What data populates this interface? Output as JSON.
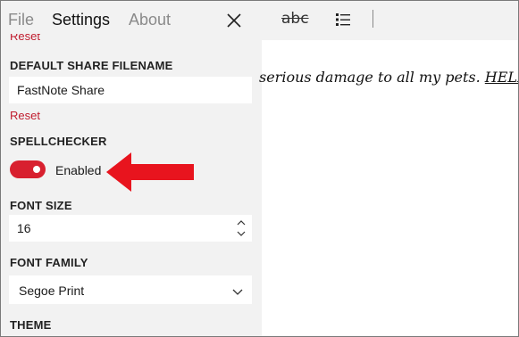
{
  "tabs": {
    "file": "File",
    "settings": "Settings",
    "about": "About"
  },
  "settings": {
    "reset_top": "Reset",
    "share_filename": {
      "label": "DEFAULT SHARE FILENAME",
      "value": "FastNote Share",
      "reset": "Reset"
    },
    "spellchecker": {
      "label": "SPELLCHECKER",
      "state": "Enabled",
      "on": true
    },
    "font_size": {
      "label": "FONT SIZE",
      "value": "16"
    },
    "font_family": {
      "label": "FONT FAMILY",
      "value": "Segoe Print"
    },
    "theme": {
      "label": "THEME"
    }
  },
  "toolbar": {
    "spellcheck_glyph": "abc"
  },
  "editor": {
    "text": "serious damage to all my pets. ",
    "link_text": "HELP"
  },
  "colors": {
    "accent_red": "#d8202f",
    "reset_red": "#c01c2e",
    "pane_bg": "#f2f2f2",
    "annotation_arrow": "#e8141e"
  }
}
